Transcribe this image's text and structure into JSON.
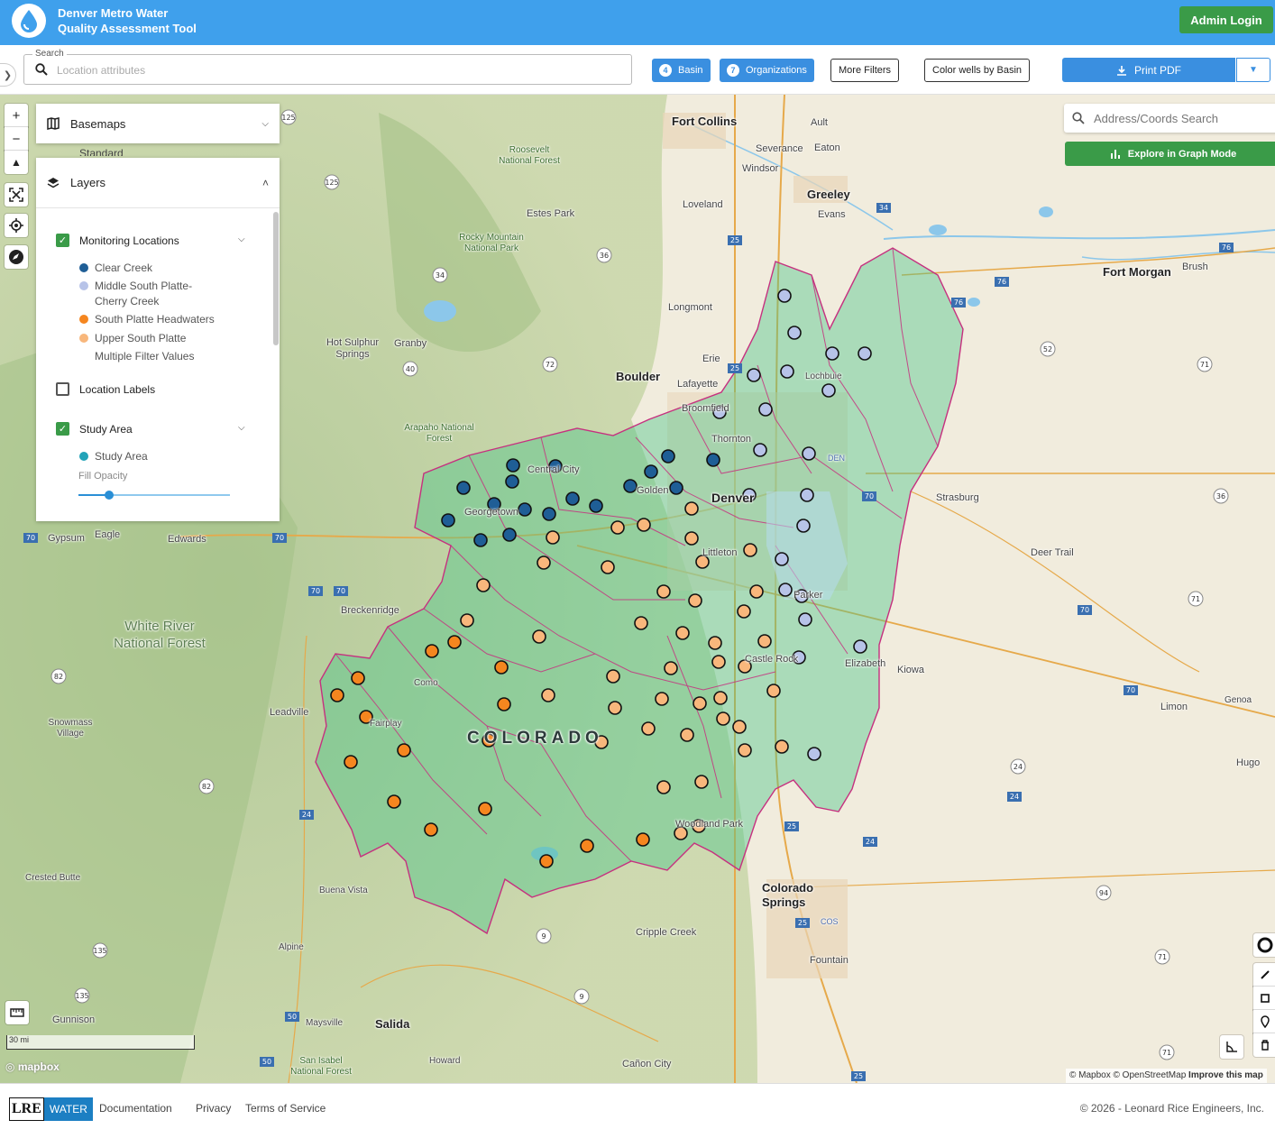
{
  "header": {
    "app_title_line1": "Denver Metro Water",
    "app_title_line2": "Quality Assessment Tool",
    "admin_login": "Admin Login"
  },
  "toolbar": {
    "search_label": "Search",
    "search_placeholder": "Location attributes",
    "basin_label": "Basin",
    "basin_count": "4",
    "organizations_label": "Organizations",
    "organizations_count": "7",
    "more_filters": "More Filters",
    "color_wells": "Color wells by Basin",
    "print_pdf": "Print PDF"
  },
  "map_controls": {
    "zoom_in": "+",
    "zoom_out": "−"
  },
  "panel": {
    "basemaps_title": "Basemaps",
    "basemaps_peek": "Standard",
    "layers_title": "Layers",
    "monitoring_label": "Monitoring Locations",
    "legend": [
      {
        "label": "Clear Creek",
        "color": "#1f5e96"
      },
      {
        "label": "Middle South Platte-Cherry Creek",
        "color": "#b7c3e8"
      },
      {
        "label": "South Platte Headwaters",
        "color": "#f5861f"
      },
      {
        "label": "Upper South Platte",
        "color": "#f8b77c"
      },
      {
        "label": "Multiple Filter Values",
        "color": "#ffffff"
      }
    ],
    "location_labels": "Location Labels",
    "study_area_label": "Study Area",
    "study_area_item": "Study Area",
    "study_area_color": "#22a3b8",
    "fill_opacity": "Fill Opacity",
    "fill_opacity_value": 0.2
  },
  "map_right": {
    "geo_search_placeholder": "Address/Coords Search",
    "graph_mode": "Explore in Graph Mode"
  },
  "map_labels": {
    "fort_collins": "Fort Collins",
    "ault": "Ault",
    "severance": "Severance",
    "eaton": "Eaton",
    "windsor": "Windsor",
    "greeley": "Greeley",
    "loveland": "Loveland",
    "evans": "Evans",
    "estes_park": "Estes Park",
    "roosevelt_nf": "Roosevelt National Forest",
    "rmnp": "Rocky Mountain National Park",
    "fort_morgan": "Fort Morgan",
    "brush": "Brush",
    "longmont": "Longmont",
    "hot_sulphur": "Hot Sulphur Springs",
    "granby": "Granby",
    "erie": "Erie",
    "boulder": "Boulder",
    "lafayette": "Lafayette",
    "lochbuie": "Lochbuie",
    "broomfield": "Broomfield",
    "thornton": "Thornton",
    "arapaho_nf": "Arapaho National Forest",
    "den": "DEN",
    "central_city": "Central City",
    "golden": "Golden",
    "denver": "Denver",
    "strasburg": "Strasburg",
    "georgetown": "Georgetown",
    "gypsum": "Gypsum",
    "eagle": "Eagle",
    "edwards": "Edwards",
    "littleton": "Littleton",
    "deer_trail": "Deer Trail",
    "parker": "Parker",
    "breckenridge": "Breckenridge",
    "white_river": "White River National Forest",
    "castle_rock": "Castle Rock",
    "elizabeth": "Elizabeth",
    "kiowa": "Kiowa",
    "como": "Como",
    "leadville": "Leadville",
    "snowmass": "Snowmass Village",
    "fairplay": "Fairplay",
    "colorado": "COLORADO",
    "limon": "Limon",
    "genoa": "Genoa",
    "hugo": "Hugo",
    "woodland_park": "Woodland Park",
    "crested_butte": "Crested Butte",
    "buena_vista": "Buena Vista",
    "colorado_springs": "Colorado Springs",
    "cos": "COS",
    "cripple_creek": "Cripple Creek",
    "alpine": "Alpine",
    "fountain": "Fountain",
    "gunnison": "Gunnison",
    "maysville": "Maysville",
    "salida": "Salida",
    "san_isabel": "San Isabel National Forest",
    "howard": "Howard",
    "canon_city": "Cañon City"
  },
  "map_footer": {
    "scale": "30 mi",
    "mapbox": "mapbox",
    "attribution_mapbox": "© Mapbox",
    "attribution_osm": "© OpenStreetMap",
    "attribution_improve": "Improve this map"
  },
  "footer": {
    "logo_left": "LRE",
    "logo_right": "WATER",
    "documentation": "Documentation",
    "privacy": "Privacy",
    "terms": "Terms of Service",
    "copyright": "© 2026 - Leonard Rice Engineers, Inc."
  }
}
